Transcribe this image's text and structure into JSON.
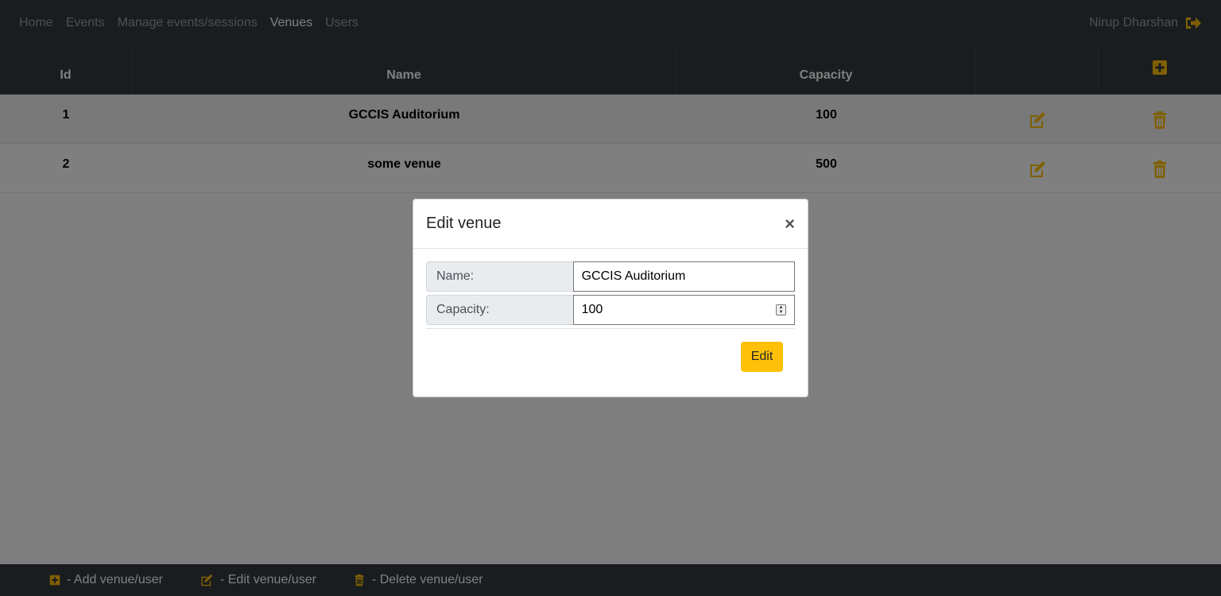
{
  "navbar": {
    "links": [
      {
        "label": "Home"
      },
      {
        "label": "Events"
      },
      {
        "label": "Manage events/sessions"
      },
      {
        "label": "Venues"
      },
      {
        "label": "Users"
      }
    ],
    "active": "Venues",
    "user_name": "Nirup Dharshan",
    "logout_icon": "sign-out-icon"
  },
  "table": {
    "headers": {
      "id": "Id",
      "name": "Name",
      "capacity": "Capacity"
    },
    "add_icon": "plus-square-icon",
    "rows": [
      {
        "id": "1",
        "name": "GCCIS Auditorium",
        "capacity": "100"
      },
      {
        "id": "2",
        "name": "some venue",
        "capacity": "500"
      }
    ],
    "edit_icon": "edit-icon",
    "delete_icon": "trash-icon"
  },
  "modal": {
    "title": "Edit venue",
    "close": "×",
    "name_label": "Name:",
    "name_value": "GCCIS Auditorium",
    "capacity_label": "Capacity:",
    "capacity_value": "100",
    "submit_label": "Edit"
  },
  "footer": {
    "legend": [
      {
        "icon": "plus-square-icon",
        "label": " - Add venue/user"
      },
      {
        "icon": "edit-icon",
        "label": " - Edit venue/user"
      },
      {
        "icon": "trash-icon",
        "label": " - Delete venue/user"
      }
    ]
  },
  "colors": {
    "accent": "#ffc107",
    "dark": "#343a40"
  }
}
